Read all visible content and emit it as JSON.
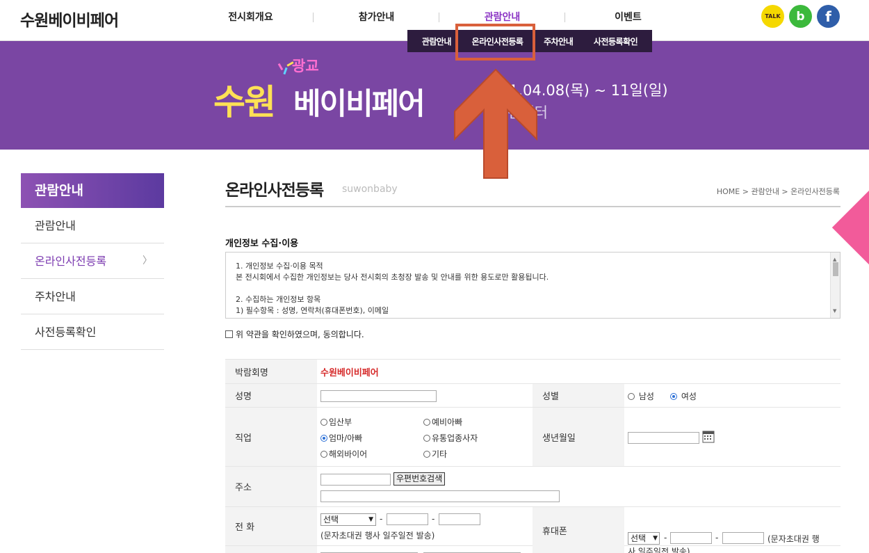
{
  "header": {
    "logo": "수원베이비페어",
    "nav": [
      "전시회개요",
      "참가안내",
      "관람안내",
      "이벤트"
    ],
    "active_nav": "관람안내",
    "sns": {
      "kakao": "TALK",
      "band": "b",
      "facebook": "f"
    },
    "submenu": [
      "관람안내",
      "온라인사전등록",
      "주차안내",
      "사전등록확인"
    ]
  },
  "banner": {
    "tag": "광교",
    "brand_a": "수원",
    "brand_b": "베이비페어",
    "date": "1.04.08(목) ~ 11일(일)",
    "venue": "션센터"
  },
  "sidebar": {
    "title": "관람안내",
    "items": [
      {
        "label": "관람안내"
      },
      {
        "label": "온라인사전등록",
        "active": true
      },
      {
        "label": "주차안내"
      },
      {
        "label": "사전등록확인"
      }
    ]
  },
  "main": {
    "title": "온라인사전등록",
    "subtitle": "suwonbaby",
    "breadcrumb": "HOME > 관람안내 > 온라인사전등록",
    "policy_title": "개인정보 수집·이용",
    "policy_lines": [
      "1. 개인정보 수집·이용 목적",
      "본 전시회에서 수집한 개인정보는 당사 전시회의 초청장 발송 및 안내를 위한 용도로만 활용됩니다.",
      "",
      "2. 수집하는 개인정보 항목",
      "1) 필수항목 : 성명, 연락처(휴대폰번호), 이메일"
    ],
    "agree_label": "위 약관을 확인하였으며, 동의합니다."
  },
  "form": {
    "fair_label": "박람회명",
    "fair_value": "수원베이비페어",
    "name_label": "성명",
    "gender_label": "성별",
    "gender_options": [
      "남성",
      "여성"
    ],
    "gender_selected": "여성",
    "job_label": "직업",
    "job_options": [
      "임산부",
      "예비아빠",
      "엄마/아빠",
      "유통업종사자",
      "해외바이어",
      "기타"
    ],
    "job_selected": "엄마/아빠",
    "birth_label": "생년월일",
    "address_label": "주소",
    "zip_button": "우편번호검색",
    "phone_label": "전 화",
    "phone_select": "선택",
    "phone_note": "(문자초대권 행사 일주일전 발송)",
    "mobile_label": "휴대폰",
    "mobile_select": "선택",
    "mobile_note": "(문자초대권 행",
    "mobile_note2": "사 일주일전 발송)",
    "dash": "-"
  },
  "colors": {
    "banner": "#7a46a3",
    "accent": "#8a33c4",
    "highlight": "#d9603b",
    "badge": "#f25b9a"
  }
}
